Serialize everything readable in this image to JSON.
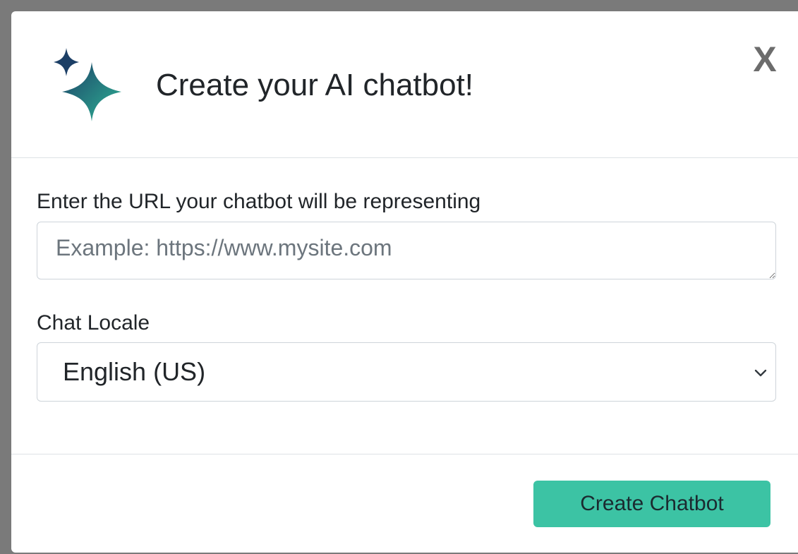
{
  "modal": {
    "title": "Create your AI chatbot!",
    "close_label": "X",
    "logo_icon": "sparkle-icon"
  },
  "form": {
    "url_label": "Enter the URL your chatbot will be representing",
    "url_value": "",
    "url_placeholder": "Example: https://www.mysite.com",
    "locale_label": "Chat Locale",
    "locale_value": "English (US)",
    "locale_icon": "chevron-down-icon"
  },
  "footer": {
    "create_label": "Create Chatbot"
  },
  "colors": {
    "accent": "#3cc3a4",
    "sparkle_dark": "#1c3f66",
    "sparkle_teal": "#2aa38c",
    "overlay": "#7a7a7a"
  }
}
